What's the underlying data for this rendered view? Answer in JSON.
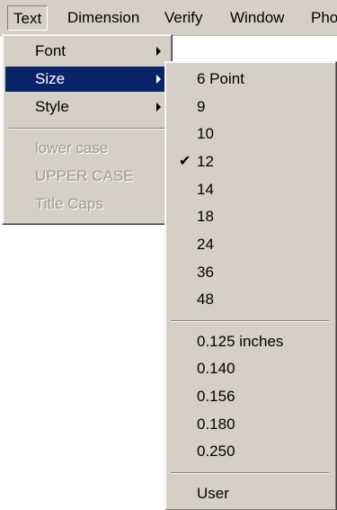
{
  "menubar": {
    "items": [
      {
        "label": "Text",
        "pressed": true
      },
      {
        "label": "Dimension"
      },
      {
        "label": "Verify"
      },
      {
        "label": "Window"
      },
      {
        "label": "Pho"
      }
    ]
  },
  "text_menu": {
    "items": [
      {
        "label": "Font",
        "submenu": true
      },
      {
        "label": "Size",
        "submenu": true,
        "highlighted": true
      },
      {
        "label": "Style",
        "submenu": true
      },
      {
        "label": "lower case",
        "disabled": true
      },
      {
        "label": "UPPER CASE",
        "disabled": true
      },
      {
        "label": "Title  Caps",
        "disabled": true
      }
    ]
  },
  "size_menu": {
    "items": [
      {
        "label": "6 Point"
      },
      {
        "label": "9"
      },
      {
        "label": "10"
      },
      {
        "label": "12",
        "checked": true
      },
      {
        "label": "14"
      },
      {
        "label": "18"
      },
      {
        "label": "24"
      },
      {
        "label": "36"
      },
      {
        "label": "48"
      },
      {
        "label": "0.125 inches"
      },
      {
        "label": "0.140"
      },
      {
        "label": "0.156"
      },
      {
        "label": "0.180"
      },
      {
        "label": "0.250"
      },
      {
        "label": "User"
      }
    ],
    "check_glyph": "✔"
  },
  "colors": {
    "menu_face": "#d4d0c8",
    "highlight": "#0a246a",
    "disabled_text": "#9c9a94"
  }
}
